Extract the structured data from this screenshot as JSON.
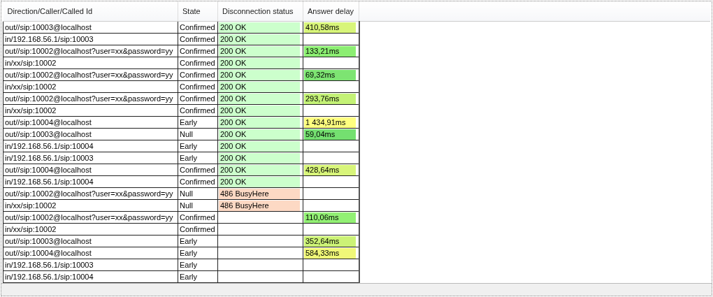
{
  "table": {
    "columns": [
      "Direction/Caller/Called Id",
      "State",
      "Disconnection status",
      "Answer delay"
    ],
    "rows": [
      {
        "id": "out//sip:10003@localhost",
        "state": "Confirmed",
        "status": {
          "text": "200 OK",
          "color": "#ccffcc"
        },
        "delay": {
          "text": "410,58ms",
          "color": "#d8f57a"
        }
      },
      {
        "id": "in/192.168.56.1/sip:10003",
        "state": "Confirmed",
        "status": {
          "text": "200 OK",
          "color": "#ccffcc"
        }
      },
      {
        "id": "out//sip:10002@localhost?user=xx&password=yy",
        "state": "Confirmed",
        "status": {
          "text": "200 OK",
          "color": "#ccffcc"
        },
        "delay": {
          "text": "133,21ms",
          "color": "#8cee72"
        }
      },
      {
        "id": "in/xx/sip:10002",
        "state": "Confirmed",
        "status": {
          "text": "200 OK",
          "color": "#ccffcc"
        }
      },
      {
        "id": "out//sip:10002@localhost?user=xx&password=yy",
        "state": "Confirmed",
        "status": {
          "text": "200 OK",
          "color": "#ccffcc"
        },
        "delay": {
          "text": "69,32ms",
          "color": "#7de472"
        }
      },
      {
        "id": "in/xx/sip:10002",
        "state": "Confirmed",
        "status": {
          "text": "200 OK",
          "color": "#ccffcc"
        }
      },
      {
        "id": "out//sip:10002@localhost?user=xx&password=yy",
        "state": "Confirmed",
        "status": {
          "text": "200 OK",
          "color": "#ccffcc"
        },
        "delay": {
          "text": "293,76ms",
          "color": "#c4f276"
        }
      },
      {
        "id": "in/xx/sip:10002",
        "state": "Confirmed",
        "status": {
          "text": "200 OK",
          "color": "#ccffcc"
        }
      },
      {
        "id": "out//sip:10004@localhost",
        "state": "Early",
        "status": {
          "text": "200 OK",
          "color": "#ccffcc"
        },
        "delay": {
          "text": "1 434,91ms",
          "color": "#ffff80"
        }
      },
      {
        "id": "out//sip:10003@localhost",
        "state": "Null",
        "status": {
          "text": "200 OK",
          "color": "#ccffcc"
        },
        "delay": {
          "text": "59,04ms",
          "color": "#74e070"
        }
      },
      {
        "id": "in/192.168.56.1/sip:10004",
        "state": "Early",
        "status": {
          "text": "200 OK",
          "color": "#ccffcc"
        }
      },
      {
        "id": "in/192.168.56.1/sip:10003",
        "state": "Early",
        "status": {
          "text": "200 OK",
          "color": "#ccffcc"
        }
      },
      {
        "id": "out//sip:10004@localhost",
        "state": "Confirmed",
        "status": {
          "text": "200 OK",
          "color": "#ccffcc"
        },
        "delay": {
          "text": "428,64ms",
          "color": "#d8f57a"
        }
      },
      {
        "id": "in/192.168.56.1/sip:10004",
        "state": "Confirmed",
        "status": {
          "text": "200 OK",
          "color": "#ccffcc"
        }
      },
      {
        "id": "out//sip:10002@localhost?user=xx&password=yy",
        "state": "Null",
        "status": {
          "text": "486 BusyHere",
          "color": "#fdd9c4"
        }
      },
      {
        "id": "in/xx/sip:10002",
        "state": "Null",
        "status": {
          "text": "486 BusyHere",
          "color": "#fdd9c4"
        }
      },
      {
        "id": "out//sip:10002@localhost?user=xx&password=yy",
        "state": "Confirmed",
        "delay": {
          "text": "110,06ms",
          "color": "#92f074"
        }
      },
      {
        "id": "in/xx/sip:10002",
        "state": "Confirmed"
      },
      {
        "id": "out//sip:10003@localhost",
        "state": "Early",
        "delay": {
          "text": "352,64ms",
          "color": "#ccf276"
        }
      },
      {
        "id": "out//sip:10004@localhost",
        "state": "Early",
        "delay": {
          "text": "584,33ms",
          "color": "#f0f878"
        }
      },
      {
        "id": "in/192.168.56.1/sip:10003",
        "state": "Early"
      },
      {
        "id": "in/192.168.56.1/sip:10004",
        "state": "Early"
      }
    ]
  }
}
